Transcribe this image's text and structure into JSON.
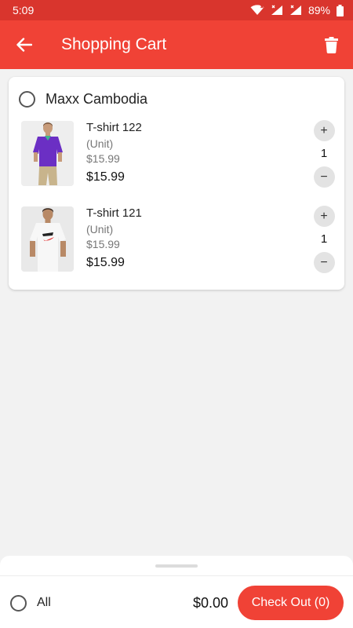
{
  "status_bar": {
    "time": "5:09",
    "battery": "89%"
  },
  "header": {
    "title": "Shopping Cart"
  },
  "store": {
    "name": "Maxx Cambodia"
  },
  "items": [
    {
      "name": "T-shirt 122",
      "unit": "(Unit)",
      "unit_price": "$15.99",
      "price": "$15.99",
      "quantity": "1",
      "plus": "+",
      "minus": "−",
      "shirt_color": "#6b2fc4"
    },
    {
      "name": "T-shirt 121",
      "unit": "(Unit)",
      "unit_price": "$15.99",
      "price": "$15.99",
      "quantity": "1",
      "plus": "+",
      "minus": "−",
      "shirt_color": "#f7f7f7"
    }
  ],
  "footer": {
    "all_label": "All",
    "total": "$0.00",
    "checkout_label": "Check Out (0)"
  },
  "colors": {
    "primary": "#f04236",
    "status_bar": "#d9352d"
  }
}
